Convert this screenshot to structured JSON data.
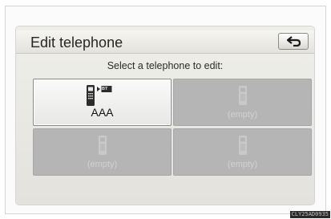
{
  "header": {
    "title": "Edit telephone"
  },
  "prompt": "Select a telephone to edit:",
  "phones": [
    {
      "label": "AAA",
      "state": "selected-bluetooth"
    },
    {
      "label": "(empty)",
      "state": "empty"
    },
    {
      "label": "(empty)",
      "state": "empty"
    },
    {
      "label": "(empty)",
      "state": "empty"
    }
  ],
  "badge": {
    "bt_mark": "BT"
  },
  "footer": {
    "code": "CLY25AD0935"
  },
  "icons": {
    "back": "return-arrow-icon",
    "phone": "mobile-phone-icon"
  },
  "colors": {
    "background": "#efefea",
    "empty_tile": "#b5b5b5",
    "active_tile": "#f2f2f0"
  }
}
